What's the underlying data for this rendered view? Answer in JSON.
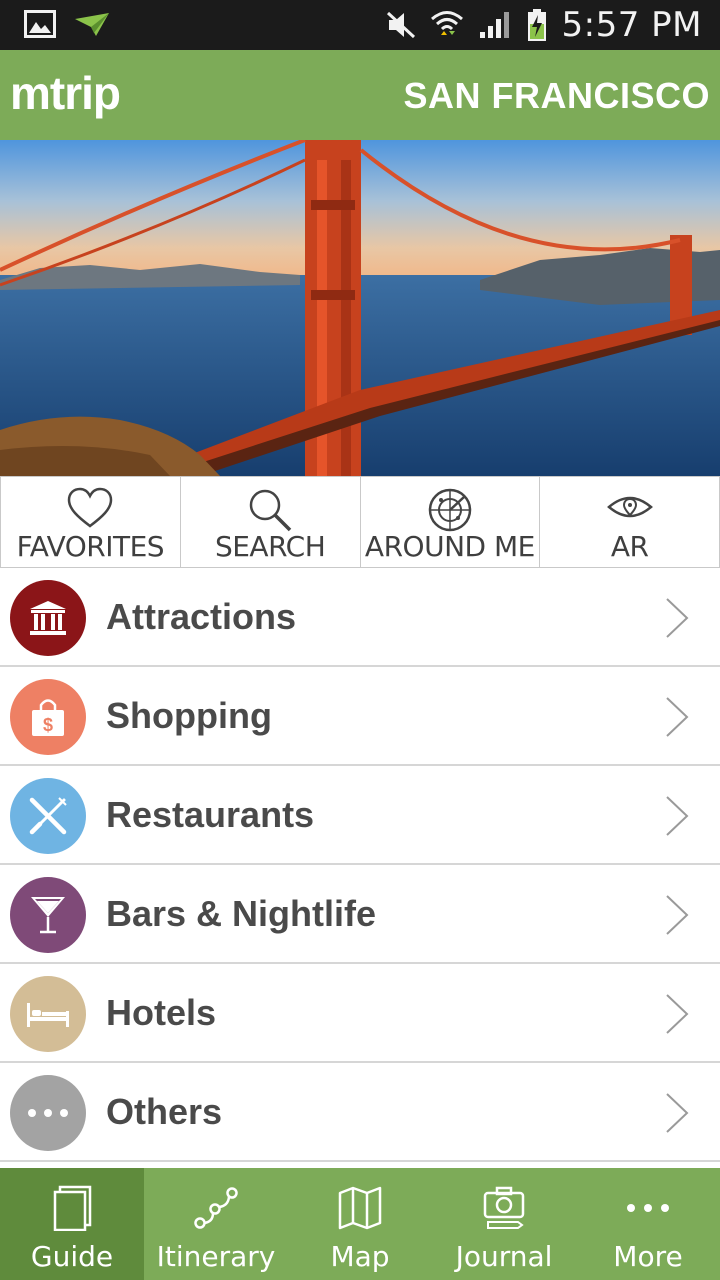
{
  "status_bar": {
    "time": "5:57 PM",
    "icons": [
      "gallery-icon",
      "send-icon",
      "mute-icon",
      "wifi-icon",
      "signal-icon",
      "battery-charging-icon"
    ]
  },
  "header": {
    "brand": "mtrip",
    "city": "SAN FRANCISCO"
  },
  "hero": {
    "subject": "golden-gate-bridge-photo"
  },
  "quick_actions": [
    {
      "label": "FAVORITES",
      "icon": "heart-icon"
    },
    {
      "label": "SEARCH",
      "icon": "search-icon"
    },
    {
      "label": "AROUND ME",
      "icon": "radar-icon"
    },
    {
      "label": "AR",
      "icon": "eye-icon"
    }
  ],
  "categories": [
    {
      "label": "Attractions",
      "icon": "museum-icon",
      "color": "#8b1518"
    },
    {
      "label": "Shopping",
      "icon": "shopping-bag-icon",
      "color": "#ee8064"
    },
    {
      "label": "Restaurants",
      "icon": "cutlery-icon",
      "color": "#6fb4e3"
    },
    {
      "label": "Bars & Nightlife",
      "icon": "cocktail-icon",
      "color": "#7f4a78"
    },
    {
      "label": "Hotels",
      "icon": "bed-icon",
      "color": "#d3bd96"
    },
    {
      "label": "Others",
      "icon": "more-dots-icon",
      "color": "#a3a3a3"
    }
  ],
  "tabs": [
    {
      "label": "Guide",
      "icon": "book-icon",
      "active": true
    },
    {
      "label": "Itinerary",
      "icon": "route-icon",
      "active": false
    },
    {
      "label": "Map",
      "icon": "map-icon",
      "active": false
    },
    {
      "label": "Journal",
      "icon": "camera-icon",
      "active": false
    },
    {
      "label": "More",
      "icon": "more-dots-icon",
      "active": false
    }
  ],
  "colors": {
    "brand_green": "#7dab58",
    "active_tab": "#5f8b3c",
    "status_bar": "#1b1b1b"
  }
}
